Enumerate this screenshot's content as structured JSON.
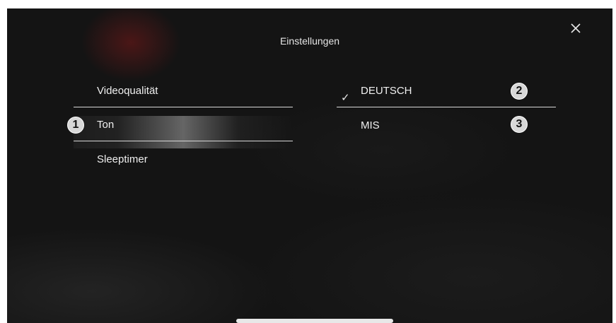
{
  "header": {
    "title": "Einstellungen"
  },
  "close_icon": "close-icon",
  "left_menu": {
    "items": [
      {
        "label": "Videoqualität"
      },
      {
        "label": "Ton",
        "badge": "1",
        "selected": true
      },
      {
        "label": "Sleeptimer"
      }
    ]
  },
  "right_menu": {
    "items": [
      {
        "label": "DEUTSCH",
        "checked": true,
        "check_glyph": "✓",
        "badge": "2"
      },
      {
        "label": "MIS",
        "badge": "3"
      }
    ]
  },
  "colors": {
    "background": "#141414",
    "text": "#f0f0f0",
    "divider": "#d8d8d8",
    "badge": "#d8d8d8"
  }
}
